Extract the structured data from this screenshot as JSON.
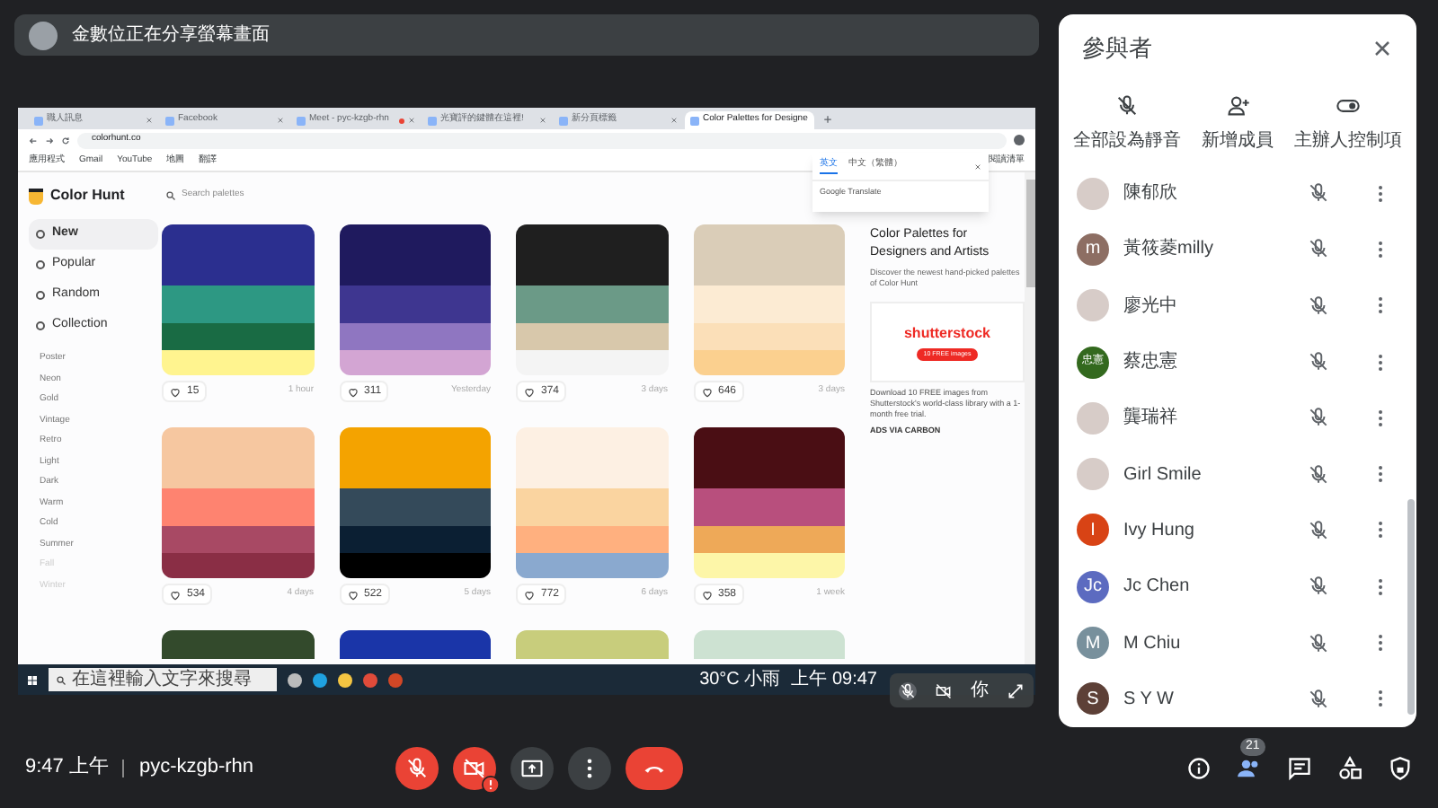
{
  "presenter_bar": {
    "text": "金數位正在分享螢幕畫面"
  },
  "shared_screen": {
    "browser_tabs": [
      {
        "label": "職人訊息",
        "selected": false
      },
      {
        "label": "Facebook",
        "selected": false
      },
      {
        "label": "Meet - pyc-kzgb-rhn",
        "selected": false,
        "recording": true
      },
      {
        "label": "光寶評的鍵體在這裡!",
        "selected": false
      },
      {
        "label": "新分頁標籤",
        "selected": false
      },
      {
        "label": "Color Palettes for Designe",
        "selected": true
      }
    ],
    "address": "colorhunt.co",
    "bookmarks": [
      "應用程式",
      "Gmail",
      "YouTube",
      "地圖",
      "翻譯"
    ],
    "reading_list": "閱讀清單",
    "translate_popup": {
      "tabs": [
        {
          "label": "英文",
          "selected": true
        },
        {
          "label": "中文（繁體）",
          "selected": false
        }
      ],
      "footer": "Google Translate"
    },
    "site": {
      "logo": "Color Hunt",
      "search": {
        "placeholder": "Search palettes"
      },
      "nav": [
        {
          "label": "New",
          "selected": true
        },
        {
          "label": "Popular",
          "selected": false
        },
        {
          "label": "Random",
          "selected": false
        },
        {
          "label": "Collection",
          "selected": false
        }
      ],
      "tags": [
        "Poster",
        "Neon",
        "Gold",
        "Vintage",
        "Retro",
        "Light",
        "Dark",
        "Warm",
        "Cold",
        "Summer",
        "Fall",
        "Winter"
      ],
      "palettes": [
        {
          "swatches": [
            {
              "color": "#2b2f8f"
            },
            {
              "color": "#2d9883"
            },
            {
              "color": "#196b44"
            },
            {
              "color": "#fff48f"
            }
          ],
          "likes": "15",
          "age": "1 hour"
        },
        {
          "swatches": [
            {
              "color": "#1f1a5e"
            },
            {
              "color": "#3e3690"
            },
            {
              "color": "#8f76c1"
            },
            {
              "color": "#d3a5d3"
            }
          ],
          "likes": "311",
          "age": "Yesterday"
        },
        {
          "swatches": [
            {
              "color": "#1f1f1f"
            },
            {
              "color": "#6b9a87"
            },
            {
              "color": "#d8c8ab"
            },
            {
              "color": "#f4f4f4"
            }
          ],
          "likes": "374",
          "age": "3 days"
        },
        {
          "swatches": [
            {
              "color": "#dacdb8"
            },
            {
              "color": "#fcebd3"
            },
            {
              "color": "#fbdfb8"
            },
            {
              "color": "#fbd08f"
            }
          ],
          "likes": "646",
          "age": "3 days"
        },
        {
          "swatches": [
            {
              "color": "#f6c7a0"
            },
            {
              "color": "#fe8370"
            },
            {
              "color": "#a84964"
            },
            {
              "color": "#8a2e45"
            }
          ],
          "likes": "534",
          "age": "4 days"
        },
        {
          "swatches": [
            {
              "color": "#f4a300"
            },
            {
              "color": "#344a5a"
            },
            {
              "color": "#0b1f33"
            },
            {
              "color": "#000000"
            }
          ],
          "likes": "522",
          "age": "5 days"
        },
        {
          "swatches": [
            {
              "color": "#fdf0e3"
            },
            {
              "color": "#fad4a0"
            },
            {
              "color": "#ffb07f"
            },
            {
              "color": "#8aa9cf"
            }
          ],
          "likes": "772",
          "age": "6 days"
        },
        {
          "swatches": [
            {
              "color": "#4a0e14"
            },
            {
              "color": "#b84f7d"
            },
            {
              "color": "#eea958"
            },
            {
              "color": "#fdf6a8"
            }
          ],
          "likes": "358",
          "age": "1 week"
        }
      ],
      "partial_palettes": [
        {
          "color": "#334a2c"
        },
        {
          "color": "#1a35a8"
        },
        {
          "color": "#c8cd7c"
        },
        {
          "color": "#cde2d2"
        }
      ],
      "aside": {
        "title": "Color Palettes for Designers and Artists",
        "text": "Discover the newest hand-picked palettes of Color Hunt",
        "ad_logo": "shutterstock",
        "ad_button": "10 FREE images",
        "ad_text": "Download 10 FREE images from Shutterstock's world-class library with a 1-month free trial.",
        "ad_footer": "ADS VIA CARBON"
      }
    },
    "taskbar": {
      "search": {
        "placeholder": "在這裡輸入文字來搜尋"
      },
      "weather": "30°C 小雨",
      "clock": "上午 09:47"
    }
  },
  "self_view": {
    "label": "你"
  },
  "participants": {
    "title": "參與者",
    "actions": [
      "全部設為靜音",
      "新增成員",
      "主辦人控制項"
    ],
    "people": [
      {
        "name": "陳郁欣",
        "kind": "image"
      },
      {
        "name": "黃筱菱milly",
        "kind": "letter",
        "initial": "m",
        "color": "#8d6e63"
      },
      {
        "name": "廖光中",
        "kind": "image"
      },
      {
        "name": "蔡忠憲",
        "kind": "letter",
        "initial": "忠憲",
        "color": "#33691e"
      },
      {
        "name": "龔瑞祥",
        "kind": "image"
      },
      {
        "name": "Girl Smile",
        "kind": "image"
      },
      {
        "name": "Ivy Hung",
        "kind": "letter",
        "initial": "I",
        "color": "#d84315"
      },
      {
        "name": "Jc Chen",
        "kind": "letter",
        "initial": "Jc",
        "color": "#5c6bc0"
      },
      {
        "name": "M Chiu",
        "kind": "letter",
        "initial": "M",
        "color": "#78909c"
      },
      {
        "name": "S Y W",
        "kind": "letter",
        "initial": "S",
        "color": "#5d4037"
      }
    ]
  },
  "bottom_bar": {
    "time": "9:47 上午",
    "meeting_code": "pyc-kzgb-rhn",
    "mic_on": false,
    "camera_on": false,
    "participant_count": "21"
  }
}
